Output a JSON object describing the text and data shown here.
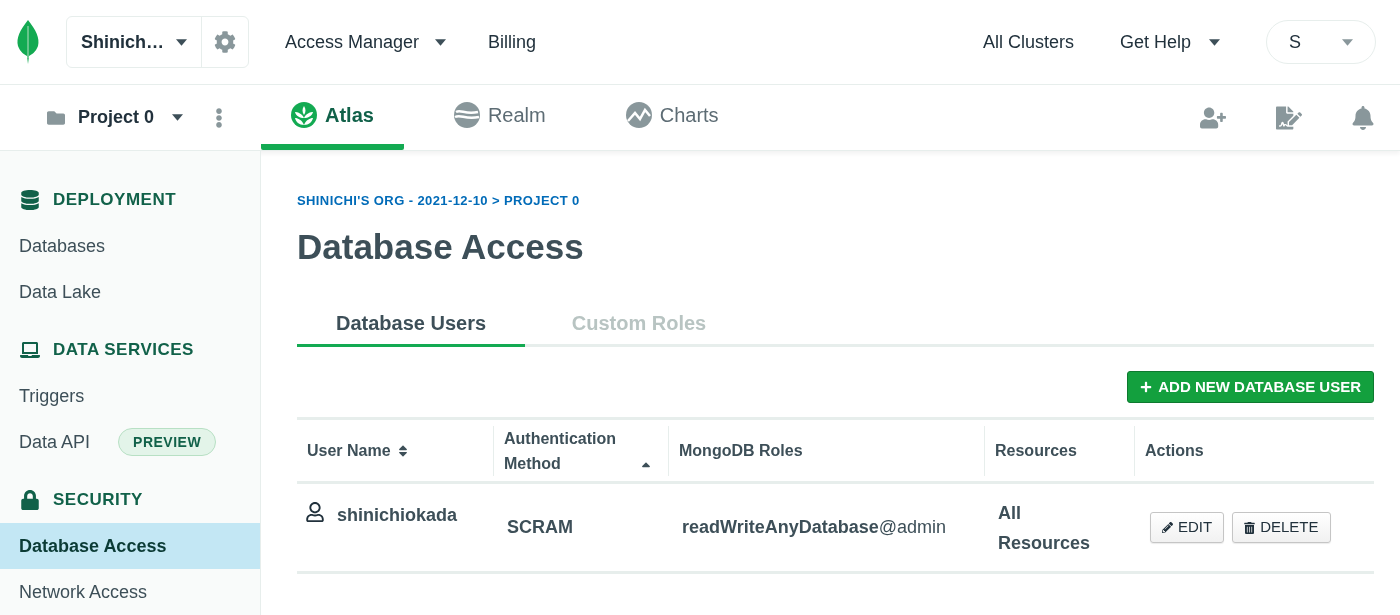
{
  "top_nav": {
    "org": "Shinich…",
    "links": [
      {
        "label": "Access Manager",
        "dropdown": true
      },
      {
        "label": "Billing",
        "dropdown": false
      }
    ],
    "right_links": [
      {
        "label": "All Clusters",
        "dropdown": false
      },
      {
        "label": "Get Help",
        "dropdown": true
      }
    ],
    "user": "S"
  },
  "project_bar": {
    "project": "Project 0",
    "products": [
      {
        "label": "Atlas",
        "kind": "atlas",
        "selected": true
      },
      {
        "label": "Realm",
        "kind": "realm",
        "selected": false
      },
      {
        "label": "Charts",
        "kind": "charts",
        "selected": false
      }
    ]
  },
  "sidebar": {
    "sections": [
      {
        "title": "DEPLOYMENT",
        "kind": "database",
        "items": [
          {
            "label": "Databases",
            "selected": false
          },
          {
            "label": "Data Lake",
            "selected": false
          }
        ]
      },
      {
        "title": "DATA SERVICES",
        "kind": "laptop",
        "items": [
          {
            "label": "Triggers",
            "selected": false
          },
          {
            "label": "Data API",
            "selected": false,
            "badge": "PREVIEW"
          }
        ]
      },
      {
        "title": "SECURITY",
        "kind": "lock",
        "items": [
          {
            "label": "Database Access",
            "selected": true
          },
          {
            "label": "Network Access",
            "selected": false
          }
        ]
      }
    ]
  },
  "breadcrumb": "SHINICHI'S ORG - 2021-12-10 > PROJECT 0",
  "title": "Database Access",
  "tabs": [
    {
      "label": "Database Users",
      "selected": true
    },
    {
      "label": "Custom Roles",
      "selected": false
    }
  ],
  "add_button": "ADD NEW DATABASE USER",
  "table": {
    "columns": [
      {
        "label": "User Name",
        "sortable": true,
        "sorted": false
      },
      {
        "label": "Authentication Method",
        "sortable": true,
        "sorted": true
      },
      {
        "label": "MongoDB Roles",
        "sortable": false
      },
      {
        "label": "Resources",
        "sortable": false
      },
      {
        "label": "Actions",
        "sortable": false
      }
    ],
    "rows": [
      {
        "user": "shinichiokada",
        "auth": "SCRAM",
        "roles": "**readWriteAnyDatabase**@admin",
        "resources": "All Resources",
        "actions": [
          {
            "label": "EDIT",
            "kind": "edit"
          },
          {
            "label": "DELETE",
            "kind": "delete"
          }
        ]
      }
    ]
  }
}
